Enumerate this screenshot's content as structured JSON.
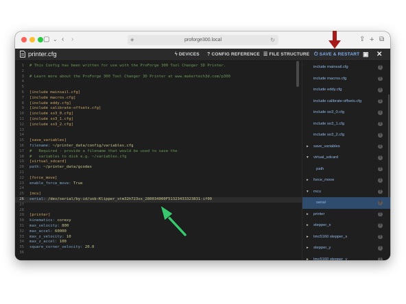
{
  "browser": {
    "address": "proforge300.local"
  },
  "app": {
    "file_title": "printer.cfg",
    "buttons": {
      "devices": "DEVICES",
      "config_reference": "CONFIG REFERENCE",
      "file_structure": "FILE STRUCTURE",
      "save_restart": "SAVE & RESTART"
    },
    "accent_color": "#7eaef0"
  },
  "editor": {
    "active_line": 26,
    "lines": [
      {
        "n": "1",
        "text": "# This Config has been written for use with the ProForge 300 Tool Changer 3D Printer.",
        "kind": "comment"
      },
      {
        "n": "2",
        "text": "",
        "kind": "plain"
      },
      {
        "n": "3",
        "text": "# Learn more about the ProForge 300 Tool Changer 3D Printer at www.makertech3d.com/p300",
        "kind": "comment"
      },
      {
        "n": "4",
        "text": "",
        "kind": "plain"
      },
      {
        "n": "5",
        "text": "",
        "kind": "plain"
      },
      {
        "n": "6",
        "text": "[include mainsail.cfg]",
        "kind": "section"
      },
      {
        "n": "7",
        "text": "[include macros.cfg]",
        "kind": "section"
      },
      {
        "n": "8",
        "text": "[include eddy.cfg]",
        "kind": "section"
      },
      {
        "n": "9",
        "text": "[include calibrate-offsets.cfg]",
        "kind": "section"
      },
      {
        "n": "10",
        "text": "[include so3_0.cfg]",
        "kind": "section"
      },
      {
        "n": "11",
        "text": "[include so3_1.cfg]",
        "kind": "section"
      },
      {
        "n": "12",
        "text": "[include so3_2.cfg]",
        "kind": "section"
      },
      {
        "n": "13",
        "text": "",
        "kind": "plain"
      },
      {
        "n": "14",
        "text": "",
        "kind": "plain"
      },
      {
        "n": "15",
        "text": "[save_variables]",
        "kind": "section"
      },
      {
        "n": "16",
        "key": "filename:",
        "val": " ~/printer_data/config/variables.cfg",
        "kind": "kv"
      },
      {
        "n": "17",
        "text": "#   Required - provide a filename that would be used to save the",
        "kind": "comment"
      },
      {
        "n": "18",
        "text": "#   variables to disk e.g. ~/variables.cfg",
        "kind": "comment"
      },
      {
        "n": "19",
        "text": "[virtual_sdcard]",
        "kind": "section"
      },
      {
        "n": "20",
        "key": "path:",
        "val": " ~/printer_data/gcodes",
        "kind": "kv"
      },
      {
        "n": "21",
        "text": "",
        "kind": "plain"
      },
      {
        "n": "22",
        "text": "[force_move]",
        "kind": "section"
      },
      {
        "n": "23",
        "key": "enable_force_move:",
        "val": " True",
        "kind": "kv"
      },
      {
        "n": "24",
        "text": "",
        "kind": "plain"
      },
      {
        "n": "25",
        "text": "[mcu]",
        "kind": "section"
      },
      {
        "n": "26",
        "key": "serial:",
        "val": " /dev/serial/by-id/usb-Klipper_stm32h723xx_280034000F51323433323831-if00",
        "kind": "kv"
      },
      {
        "n": "27",
        "text": "",
        "kind": "plain"
      },
      {
        "n": "28",
        "text": "",
        "kind": "plain"
      },
      {
        "n": "29",
        "text": "[printer]",
        "kind": "section"
      },
      {
        "n": "30",
        "key": "kinematics:",
        "val": " corexy",
        "kind": "kv"
      },
      {
        "n": "31",
        "key": "max_velocity:",
        "val": " 800",
        "kind": "kv"
      },
      {
        "n": "32",
        "key": "max_accel:",
        "val": " 60000",
        "kind": "kv"
      },
      {
        "n": "33",
        "key": "max_z_velocity:",
        "val": " 10",
        "kind": "kv"
      },
      {
        "n": "34",
        "key": "max_z_accel:",
        "val": " 100",
        "kind": "kv"
      },
      {
        "n": "35",
        "key": "square_corner_velocity:",
        "val": " 20.0",
        "kind": "kv"
      },
      {
        "n": "36",
        "text": "",
        "kind": "plain"
      }
    ]
  },
  "sidebar": {
    "items": [
      {
        "label": "include mainsail.cfg",
        "arrow": "",
        "indent": 0,
        "selected": false
      },
      {
        "label": "include macros.cfg",
        "arrow": "",
        "indent": 0,
        "selected": false
      },
      {
        "label": "include eddy.cfg",
        "arrow": "",
        "indent": 0,
        "selected": false
      },
      {
        "label": "include calibrate-offsets.cfg",
        "arrow": "",
        "indent": 0,
        "selected": false
      },
      {
        "label": "include so3_0.cfg",
        "arrow": "",
        "indent": 0,
        "selected": false
      },
      {
        "label": "include so3_1.cfg",
        "arrow": "",
        "indent": 0,
        "selected": false
      },
      {
        "label": "include so3_2.cfg",
        "arrow": "",
        "indent": 0,
        "selected": false
      },
      {
        "label": "save_variables",
        "arrow": "▸",
        "indent": 0,
        "selected": false
      },
      {
        "label": "virtual_sdcard",
        "arrow": "▾",
        "indent": 0,
        "selected": false
      },
      {
        "label": "path",
        "arrow": "",
        "indent": 1,
        "selected": false
      },
      {
        "label": "force_move",
        "arrow": "▸",
        "indent": 0,
        "selected": false
      },
      {
        "label": "mcu",
        "arrow": "▾",
        "indent": 0,
        "selected": false
      },
      {
        "label": "serial",
        "arrow": "",
        "indent": 1,
        "selected": true
      },
      {
        "label": "printer",
        "arrow": "▸",
        "indent": 0,
        "selected": false
      },
      {
        "label": "stepper_x",
        "arrow": "▸",
        "indent": 0,
        "selected": false
      },
      {
        "label": "tmc5160 stepper_x",
        "arrow": "▸",
        "indent": 0,
        "selected": false
      },
      {
        "label": "stepper_y",
        "arrow": "▸",
        "indent": 0,
        "selected": false
      },
      {
        "label": "tmc5160 stepper_y",
        "arrow": "▸",
        "indent": 0,
        "selected": false
      }
    ]
  }
}
